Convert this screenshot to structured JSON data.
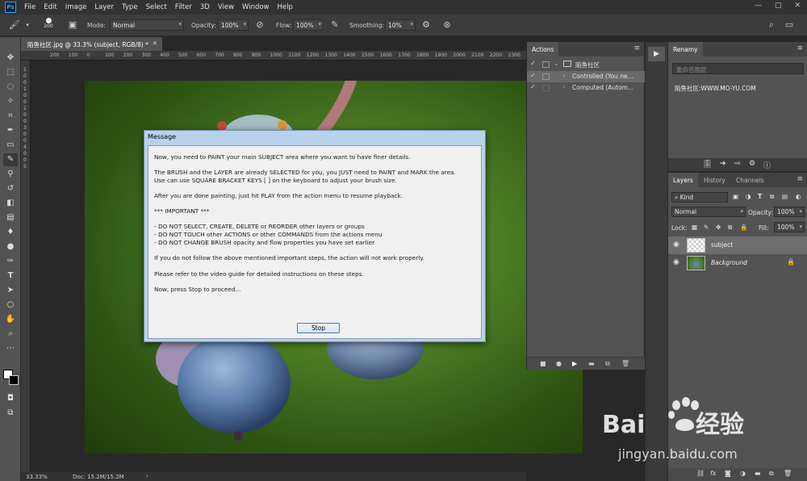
{
  "app": {
    "logo": "Ps"
  },
  "menu": [
    "File",
    "Edit",
    "Image",
    "Layer",
    "Type",
    "Select",
    "Filter",
    "3D",
    "View",
    "Window",
    "Help"
  ],
  "window_controls": [
    "—",
    "□",
    "✕"
  ],
  "options": {
    "brush_size": "200",
    "mode_label": "Mode:",
    "mode_value": "Normal",
    "opacity_label": "Opacity:",
    "opacity_value": "100%",
    "flow_label": "Flow:",
    "flow_value": "100%",
    "smoothing_label": "Smoothing:",
    "smoothing_value": "10%"
  },
  "document": {
    "tab_title": "陌鱼社区.jpg @ 33.3% (subject, RGB/8) *",
    "ruler_h": [
      "200",
      "100",
      "0",
      "100",
      "200",
      "300",
      "400",
      "500",
      "600",
      "700",
      "800",
      "900",
      "1000",
      "1100",
      "1200",
      "1300",
      "1400",
      "1500",
      "1600",
      "1700",
      "1800",
      "1900",
      "2000",
      "2100",
      "2200",
      "2300"
    ],
    "ruler_v": [
      "1",
      "0",
      "0",
      "1",
      "0",
      "0",
      "2",
      "0",
      "0",
      "3",
      "0",
      "0",
      "4",
      "0",
      "0",
      "5"
    ],
    "zoom": "33.33%",
    "doc_size": "Doc: 15.2M/15.2M"
  },
  "dialog": {
    "title": "Message",
    "lines": [
      "Now, you need to PAINT your main SUBJECT area where you want to have finer details.",
      "The BRUSH and the LAYER are already SELECTED for you, you JUST need to PAINT and MARK the area.",
      "Use can use SQUARE BRACKET KEYS [ ] on the keyboard to adjust your brush size.",
      "After you are done painting, just hit PLAY from the action menu to resume playback.",
      "*** IMPORTANT ***",
      "- DO NOT SELECT, CREATE, DELETE or REORDER other layers or groups",
      "- DO NOT TOUCH other ACTIONS or other COMMANDS from the actions menu",
      "- DO NOT CHANGE BRUSH opacity and flow properties you have set earlier",
      "If you do not follow the above mentioned important steps, the action will not work properly.",
      "Please refer to the video guide for detailed instructions on these steps.",
      "Now, press Stop to proceed..."
    ],
    "stop_label": "Stop"
  },
  "actions": {
    "tab": "Actions",
    "rows": [
      {
        "label": "陌鱼社区"
      },
      {
        "label": "Controlled (You ne..."
      },
      {
        "label": "Computed (Autom..."
      }
    ]
  },
  "rename": {
    "tab": "Renamy",
    "placeholder": "重命名图层",
    "preset": "陌鱼社区:WWW.MO-YU.COM"
  },
  "layers": {
    "tabs": [
      "Layers",
      "History",
      "Channels"
    ],
    "kind_label": "Kind",
    "blend_mode": "Normal",
    "opacity_label": "Opacity:",
    "opacity_value": "100%",
    "lock_label": "Lock:",
    "fill_label": "Fill:",
    "fill_value": "100%",
    "items": [
      {
        "name": "subject"
      },
      {
        "name": "Background"
      }
    ]
  },
  "watermark": {
    "brand": "Bai du 经验",
    "url": "jingyan.baidu.com"
  }
}
